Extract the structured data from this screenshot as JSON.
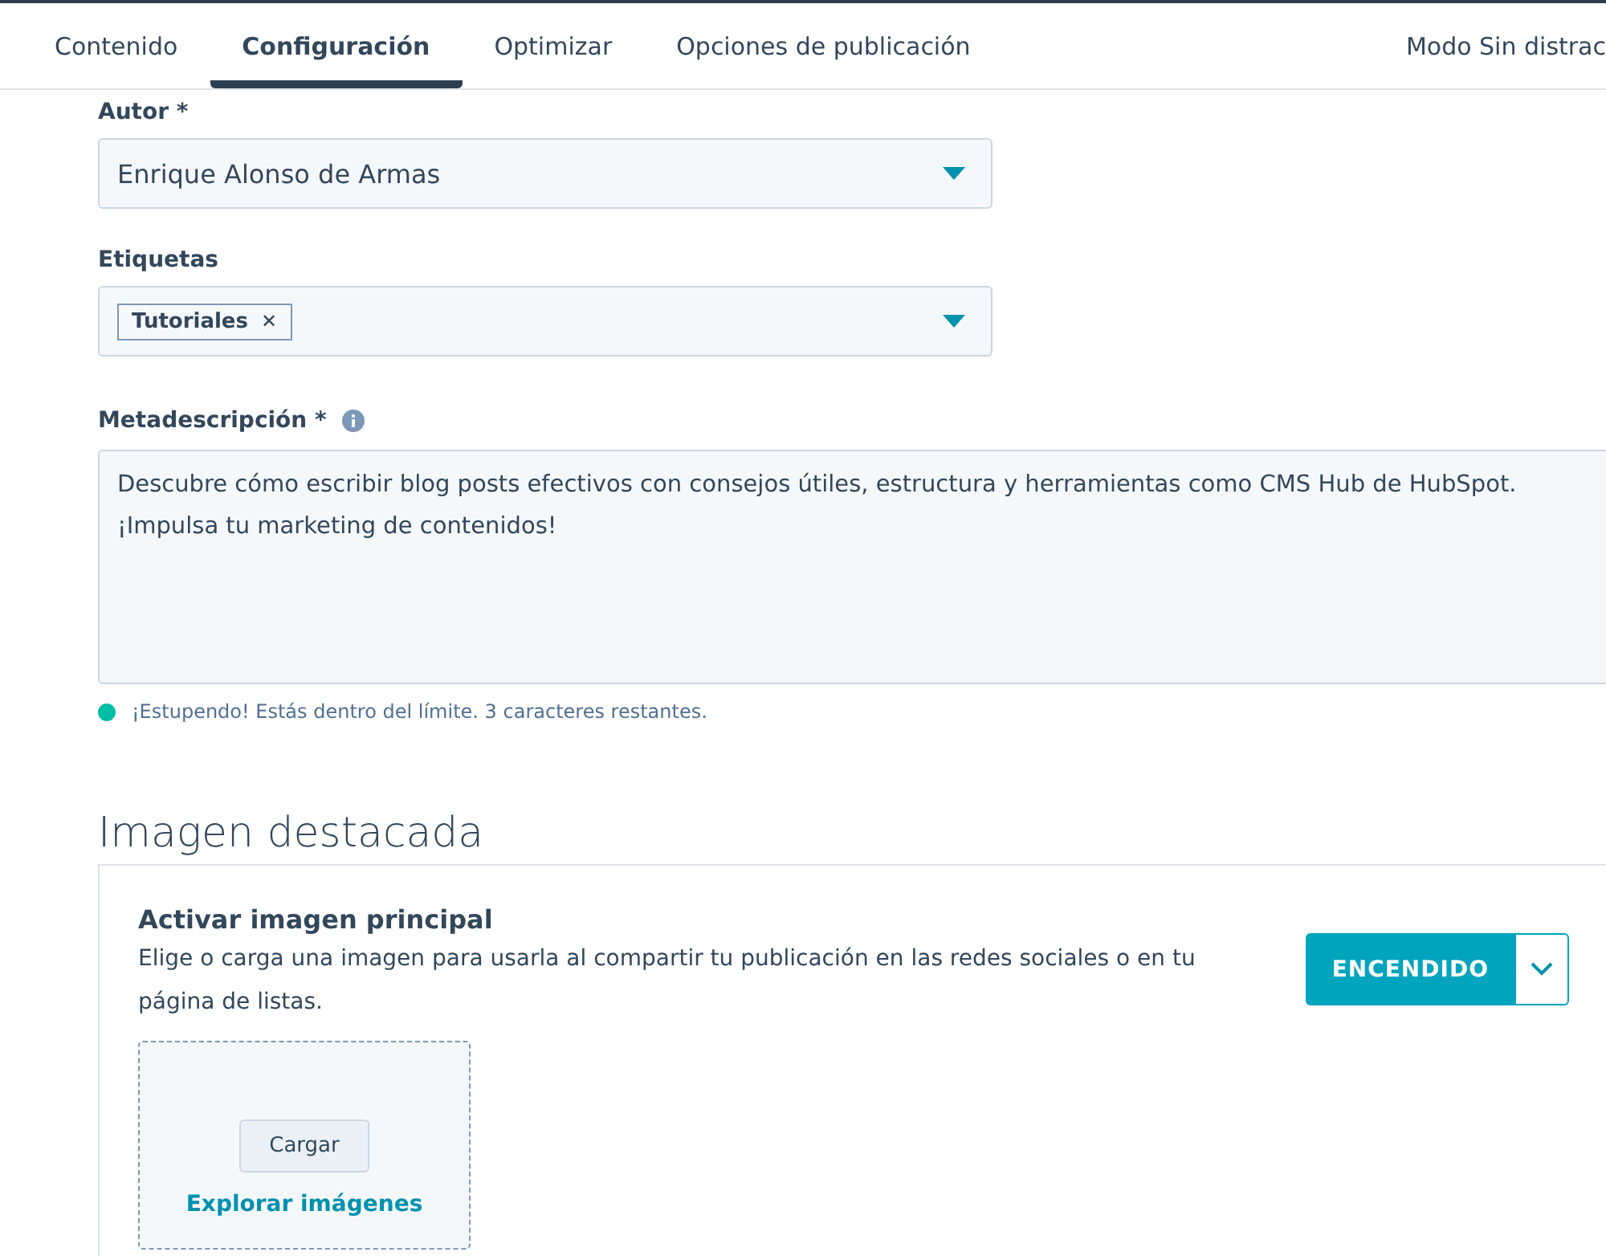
{
  "tabs": [
    {
      "label": "Contenido",
      "selected": false
    },
    {
      "label": "Configuración",
      "selected": true
    },
    {
      "label": "Optimizar",
      "selected": false
    },
    {
      "label": "Opciones de publicación",
      "selected": false
    }
  ],
  "distraction_mode": "Modo Sin distrac",
  "author": {
    "label": "Autor *",
    "value": "Enrique Alonso de Armas"
  },
  "tags": {
    "label": "Etiquetas",
    "items": [
      {
        "label": "Tutoriales",
        "remove": "✕"
      }
    ]
  },
  "meta_description": {
    "label": "Metadescripción *",
    "value": "Descubre cómo escribir blog posts efectivos con consejos útiles, estructura y herramientas como CMS Hub de HubSpot. ¡Impulsa tu marketing de contenidos!",
    "status": {
      "text": "¡Estupendo! Estás dentro del límite. 3 caracteres restantes.",
      "color": "#00bda5"
    }
  },
  "featured_image": {
    "heading": "Imagen destacada",
    "title": "Activar imagen principal",
    "description": "Elige o carga una imagen para usarla al compartir tu publicación en las redes sociales o en tu página de listas.",
    "toggle": {
      "label": "ENCENDIDO",
      "on": true
    },
    "upload_button": "Cargar",
    "browse_link": "Explorar imágenes"
  }
}
